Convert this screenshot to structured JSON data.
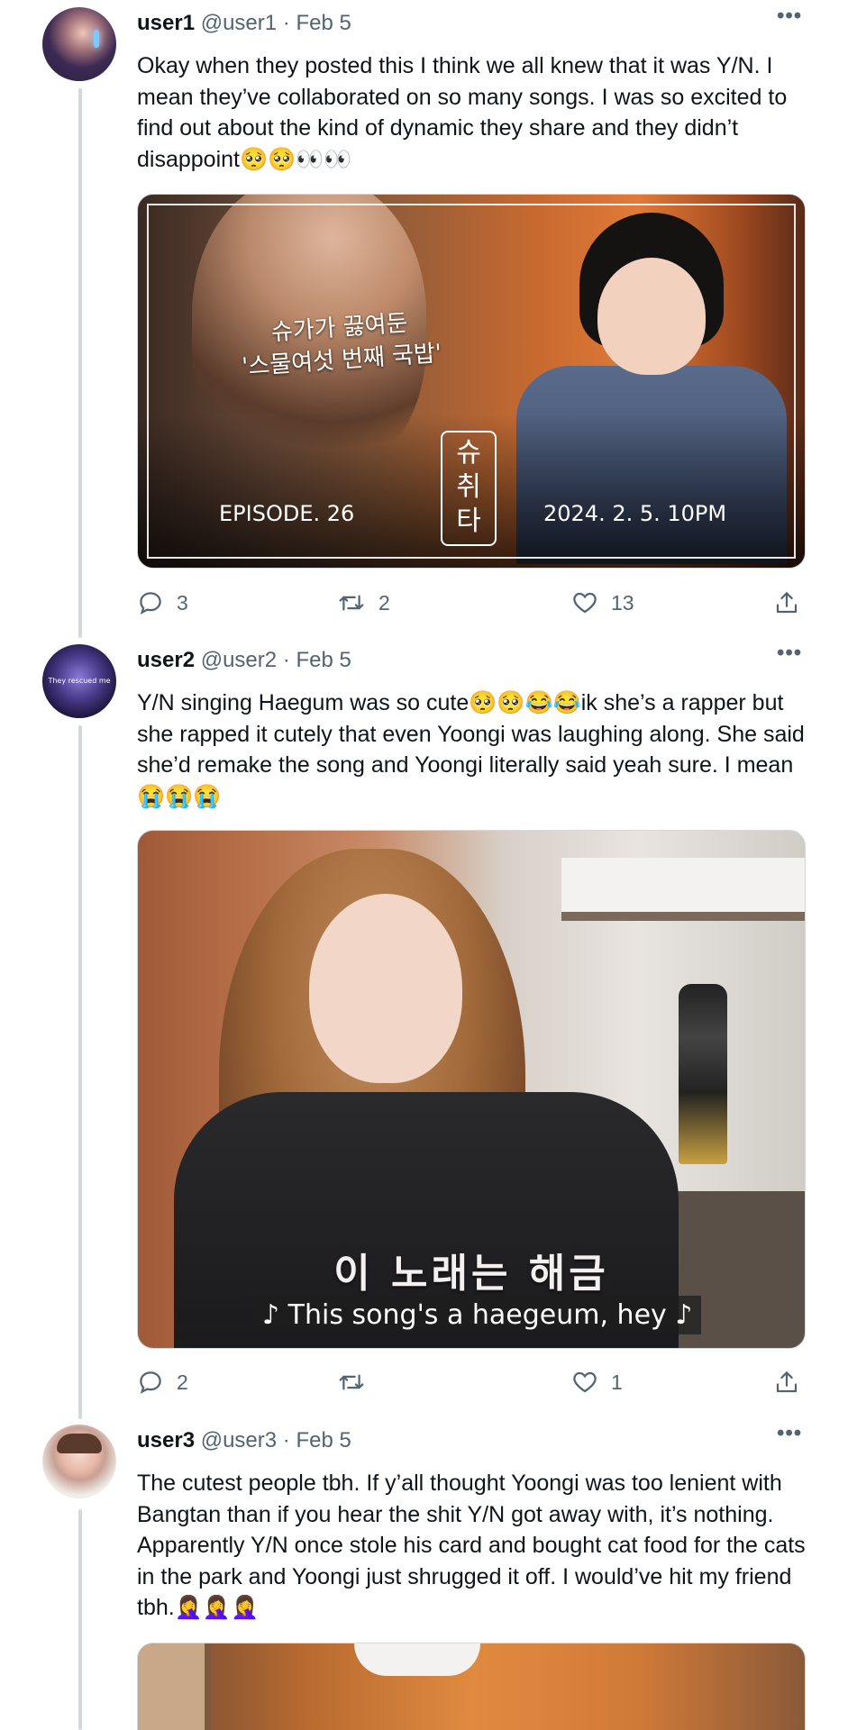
{
  "tweets": [
    {
      "name": "user1",
      "handle": "@user1 · Feb 5",
      "text": "Okay when they posted this I think we all knew that it was Y/N. I mean they’ve collaborated on so many songs. I was so excited to find out about the kind of dynamic they share and they didn’t disappoint🥺🥺👀👀",
      "media": {
        "title_ko_line1": "슈가가 끓여둔",
        "title_ko_line2": "'스물여섯 번째 국밥'",
        "logo": "슈\n취\n타",
        "episode": "EPISODE. 26",
        "date": "2024. 2. 5.   10PM"
      },
      "replies": "3",
      "retweets": "2",
      "likes": "13"
    },
    {
      "name": "user2",
      "handle": "@user2 · Feb 5",
      "avatar_text": "They rescued me",
      "text": "Y/N singing Haegum was so cute🥺🥺😂😂ik she’s a rapper but she rapped it cutely that even Yoongi was laughing along. She said she’d remake the song and Yoongi literally said yeah sure. I mean 😭😭😭",
      "media": {
        "subtitle_ko": "이 노래는 해금",
        "subtitle_en": "♪ This song's a haegeum, hey ♪"
      },
      "replies": "2",
      "retweets": "",
      "likes": "1"
    },
    {
      "name": "user3",
      "handle": "@user3 · Feb 5",
      "text": "The cutest people tbh. If y’all thought Yoongi was too lenient with Bangtan than if you hear the shit Y/N got away with, it’s nothing. Apparently Y/N once stole his card and bought cat food for the cats in the park and Yoongi just shrugged it off. I would’ve hit my friend tbh.🤦‍♀️🤦‍♀️🤦‍♀️"
    }
  ],
  "more_label": "•••",
  "icons": [
    "reply-icon",
    "retweet-icon",
    "like-icon",
    "share-icon"
  ],
  "colors": {
    "secondary_text": "#536471",
    "thread_line": "#cfd9de"
  }
}
